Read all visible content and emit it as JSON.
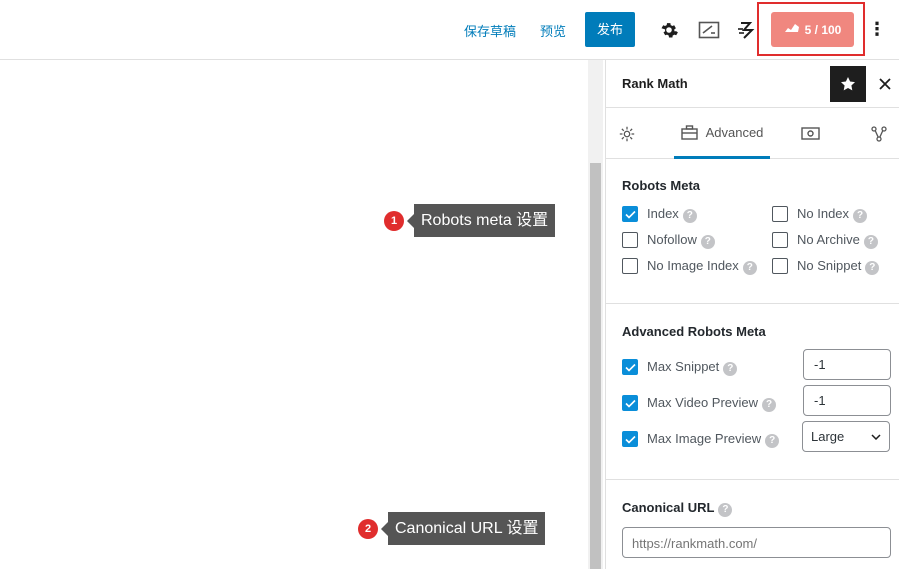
{
  "topbar": {
    "save_draft": "保存草稿",
    "preview": "预览",
    "publish": "发布",
    "score": "5 / 100",
    "icons": [
      "gear-icon",
      "preview-panel-icon",
      "seo-speed-icon",
      "rocket-icon",
      "more-vertical-icon"
    ]
  },
  "callouts": [
    {
      "num": "1",
      "label": "Robots meta 设置"
    },
    {
      "num": "2",
      "label": "Canonical URL 设置"
    }
  ],
  "sidebar": {
    "title": "Rank Math",
    "tabs": [
      {
        "icon": "gear-icon",
        "label": ""
      },
      {
        "icon": "briefcase-icon",
        "label": "Advanced"
      },
      {
        "icon": "schema-icon",
        "label": ""
      },
      {
        "icon": "share-icon",
        "label": ""
      }
    ],
    "robots_meta": {
      "title": "Robots Meta",
      "items": [
        {
          "label": "Index",
          "checked": true
        },
        {
          "label": "No Index",
          "checked": false
        },
        {
          "label": "Nofollow",
          "checked": false
        },
        {
          "label": "No Archive",
          "checked": false
        },
        {
          "label": "No Image Index",
          "checked": false
        },
        {
          "label": "No Snippet",
          "checked": false
        }
      ]
    },
    "advanced_robots_meta": {
      "title": "Advanced Robots Meta",
      "max_snippet": {
        "label": "Max Snippet",
        "value": "-1",
        "checked": true
      },
      "max_video_preview": {
        "label": "Max Video Preview",
        "value": "-1",
        "checked": true
      },
      "max_image_preview": {
        "label": "Max Image Preview",
        "value": "Large",
        "checked": true
      }
    },
    "canonical": {
      "title": "Canonical URL",
      "placeholder": "https://rankmath.com/"
    }
  },
  "colors": {
    "accent": "#007cba",
    "score_bg": "#f0877f",
    "highlight": "#e02d2d",
    "checkbox": "#0a8ed9"
  }
}
